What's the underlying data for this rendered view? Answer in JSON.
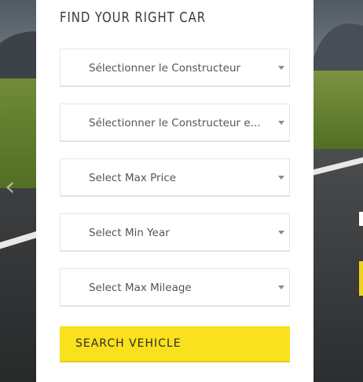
{
  "form": {
    "title": "FIND YOUR RIGHT CAR",
    "selects": [
      {
        "label": "Sélectionner le Constructeur"
      },
      {
        "label": "Sélectionner le Constructeur e..."
      },
      {
        "label": "Select Max Price"
      },
      {
        "label": "Select Min Year"
      },
      {
        "label": "Select Max Mileage"
      }
    ],
    "search_label": "SEARCH VEHICLE"
  },
  "colors": {
    "accent": "#f9e11d",
    "panel": "#ffffff",
    "text": "#3a3a3a"
  },
  "icons": {
    "carousel_prev": "chevron-left-icon",
    "select_caret": "caret-down-icon"
  }
}
